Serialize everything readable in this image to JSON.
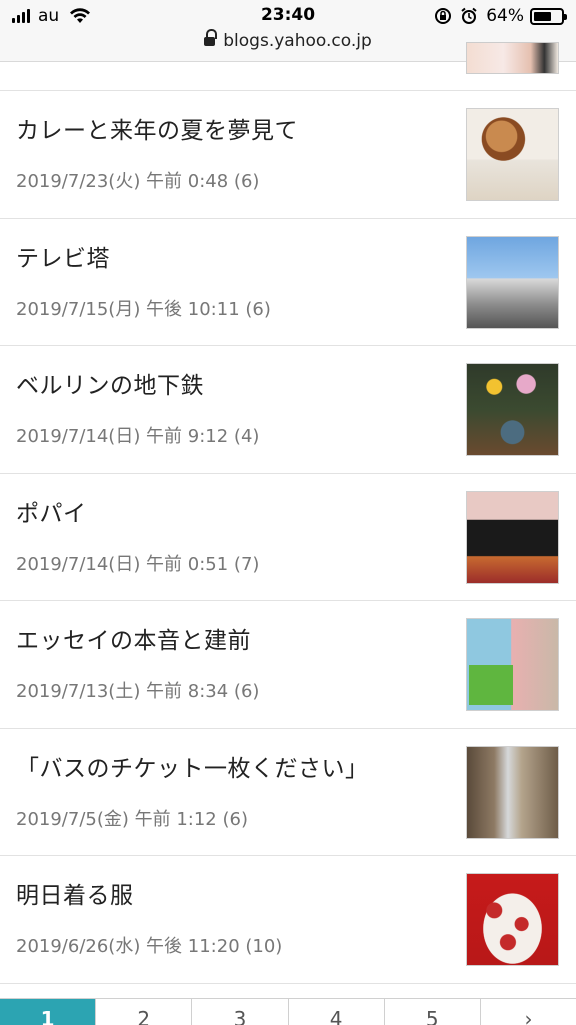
{
  "status_bar": {
    "carrier": "au",
    "time": "23:40",
    "battery": "64%",
    "battery_level": 0.64,
    "url": "blogs.yahoo.co.jp"
  },
  "posts": [
    {
      "title": "カレーと来年の夏を夢見て",
      "meta": "2019/7/23(火) 午前 0:48 (6)",
      "thumb": "curry-magazine-photo"
    },
    {
      "title": "テレビ塔",
      "meta": "2019/7/15(月) 午後 10:11 (6)",
      "thumb": "tv-tower-photo"
    },
    {
      "title": "ベルリンの地下鉄",
      "meta": "2019/7/14(日) 午前 9:12 (4)",
      "thumb": "flowers-vase-photo"
    },
    {
      "title": "ポパイ",
      "meta": "2019/7/14(日) 午前 0:51 (7)",
      "thumb": "popeye-magazine-photo"
    },
    {
      "title": "エッセイの本音と建前",
      "meta": "2019/7/13(土) 午前 8:34 (6)",
      "thumb": "books-photo"
    },
    {
      "title": "「バスのチケット一枚ください」",
      "meta": "2019/7/5(金) 午前 1:12 (6)",
      "thumb": "street-buildings-photo"
    },
    {
      "title": "明日着る服",
      "meta": "2019/6/26(水) 午後 11:20 (10)",
      "thumb": "cherry-shirt-photo"
    }
  ],
  "pagination": {
    "pages": [
      "1",
      "2",
      "3",
      "4",
      "5",
      "›"
    ],
    "active": "1"
  }
}
